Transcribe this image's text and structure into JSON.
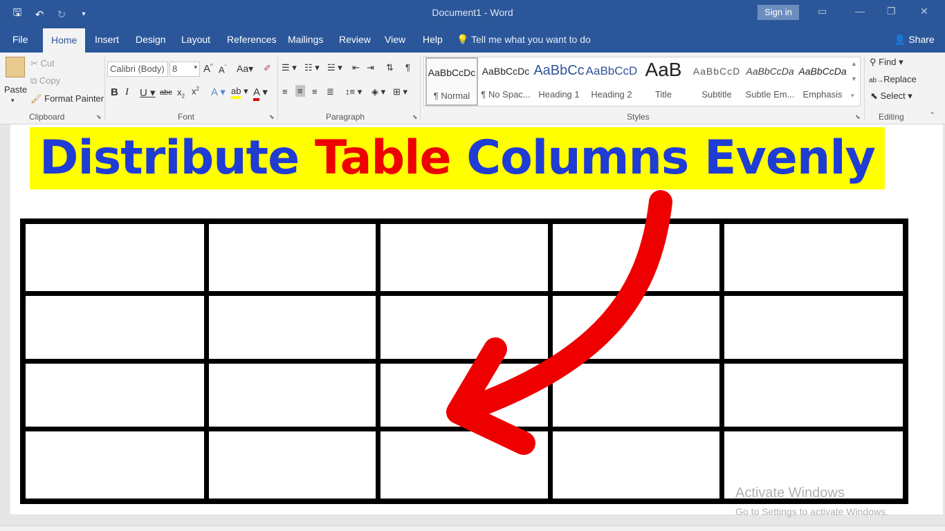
{
  "titlebar": {
    "document_title": "Document1  -  Word",
    "signin_label": "Sign in",
    "qat_icons": [
      "save-icon",
      "undo-icon",
      "redo-icon",
      "customize-icon"
    ],
    "color": "#2b579a"
  },
  "tabs": [
    {
      "label": "File"
    },
    {
      "label": "Home",
      "active": true
    },
    {
      "label": "Insert"
    },
    {
      "label": "Design"
    },
    {
      "label": "Layout"
    },
    {
      "label": "References"
    },
    {
      "label": "Mailings"
    },
    {
      "label": "Review"
    },
    {
      "label": "View"
    },
    {
      "label": "Help"
    }
  ],
  "tellme": "Tell me what you want to do",
  "share_label": "Share",
  "ribbon": {
    "clipboard": {
      "paste": "Paste",
      "cut": "Cut",
      "copy": "Copy",
      "format_painter": "Format Painter",
      "group_label": "Clipboard"
    },
    "font": {
      "font_name": "Calibri (Body)",
      "font_size": "8",
      "change_case": "Aa",
      "group_label": "Font"
    },
    "paragraph": {
      "group_label": "Paragraph"
    },
    "styles": {
      "group_label": "Styles",
      "items": [
        {
          "preview": "AaBbCcDc",
          "label": "¶ Normal",
          "selected": true
        },
        {
          "preview": "AaBbCcDc",
          "label": "¶ No Spac..."
        },
        {
          "preview": "AaBbCc",
          "label": "Heading 1"
        },
        {
          "preview": "AaBbCcD",
          "label": "Heading 2"
        },
        {
          "preview": "AaB",
          "label": "Title"
        },
        {
          "preview": "AaBbCcD",
          "label": "Subtitle"
        },
        {
          "preview": "AaBbCcDa",
          "label": "Subtle Em..."
        },
        {
          "preview": "AaBbCcDa",
          "label": "Emphasis"
        }
      ]
    },
    "editing": {
      "find": "Find",
      "replace": "Replace",
      "select": "Select",
      "group_label": "Editing"
    }
  },
  "document": {
    "headline_parts": [
      {
        "text": "Distribute ",
        "color": "#1f3cd4"
      },
      {
        "text": "Table",
        "color": "#ee0000"
      },
      {
        "text": " Columns Evenly",
        "color": "#1f3cd4"
      }
    ],
    "highlight_color": "#ffff00",
    "table": {
      "rows": 4,
      "columns": 5
    },
    "arrow_color": "#ee0000"
  },
  "watermark": {
    "line1": "Activate Windows",
    "line2": "Go to Settings to activate Windows."
  }
}
